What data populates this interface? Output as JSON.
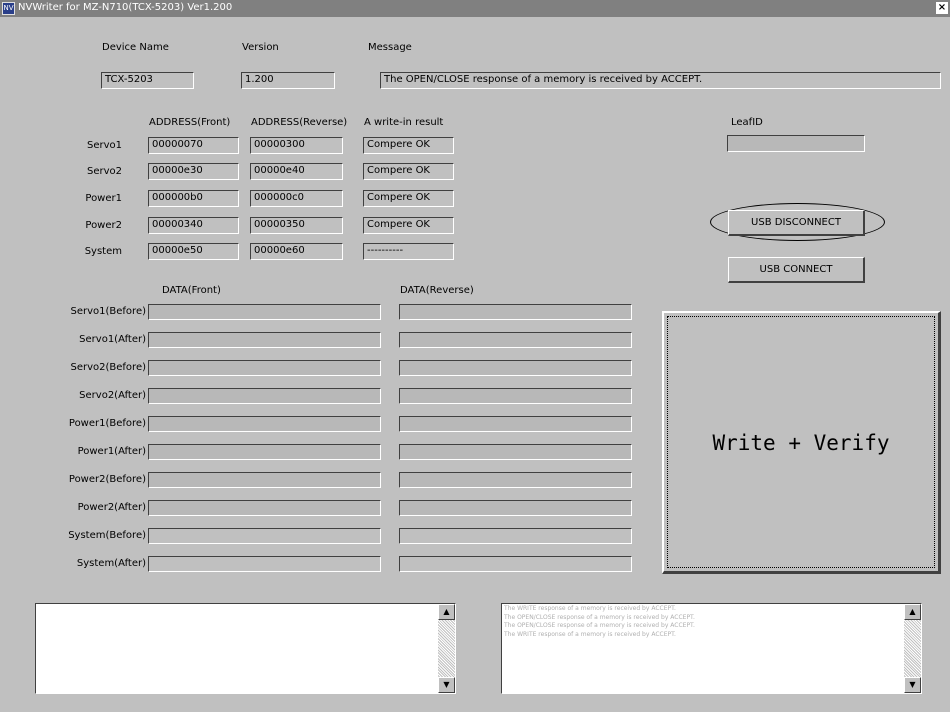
{
  "window": {
    "title": "NVWriter for MZ-N710(TCX-5203) Ver1.200",
    "icon": "app-icon",
    "close_label": "×"
  },
  "header": {
    "device_name_label": "Device Name",
    "version_label": "Version",
    "message_label": "Message",
    "device_name": "TCX-5203",
    "version": "1.200",
    "message": "The OPEN/CLOSE response of a memory is received by ACCEPT."
  },
  "address": {
    "col_front": "ADDRESS(Front)",
    "col_reverse": "ADDRESS(Reverse)",
    "col_result": "A write-in result",
    "rows": [
      {
        "name": "Servo1",
        "front": "00000070",
        "reverse": "00000300",
        "result": "Compere OK"
      },
      {
        "name": "Servo2",
        "front": "00000e30",
        "reverse": "00000e40",
        "result": "Compere OK"
      },
      {
        "name": "Power1",
        "front": "000000b0",
        "reverse": "000000c0",
        "result": "Compere OK"
      },
      {
        "name": "Power2",
        "front": "00000340",
        "reverse": "00000350",
        "result": "Compere OK"
      },
      {
        "name": "System",
        "front": "00000e50",
        "reverse": "00000e60",
        "result": "----------"
      }
    ]
  },
  "leaf": {
    "label": "LeafID",
    "value": ""
  },
  "buttons": {
    "usb_disconnect": "USB DISCONNECT",
    "usb_connect": "USB CONNECT",
    "write_verify": "Write + Verify"
  },
  "data": {
    "col_front": "DATA(Front)",
    "col_reverse": "DATA(Reverse)",
    "rows": [
      {
        "label": "Servo1(Before)",
        "front": "",
        "reverse": ""
      },
      {
        "label": "Servo1(After)",
        "front": "",
        "reverse": ""
      },
      {
        "label": "Servo2(Before)",
        "front": "",
        "reverse": ""
      },
      {
        "label": "Servo2(After)",
        "front": "",
        "reverse": ""
      },
      {
        "label": "Power1(Before)",
        "front": "",
        "reverse": ""
      },
      {
        "label": "Power1(After)",
        "front": "",
        "reverse": ""
      },
      {
        "label": "Power2(Before)",
        "front": "",
        "reverse": ""
      },
      {
        "label": "Power2(After)",
        "front": "",
        "reverse": ""
      },
      {
        "label": "System(Before)",
        "front": "",
        "reverse": ""
      },
      {
        "label": "System(After)",
        "front": "",
        "reverse": ""
      }
    ]
  },
  "logs": {
    "left": [],
    "right": [
      "",
      "The WRITE response of a memory is received by ACCEPT.",
      "",
      "The OPEN/CLOSE response of a memory is received by ACCEPT.",
      "",
      "The OPEN/CLOSE response of a memory is received by ACCEPT.",
      "",
      "The WRITE response of a memory is received by ACCEPT."
    ],
    "scroll_up": "▲",
    "scroll_down": "▼"
  }
}
